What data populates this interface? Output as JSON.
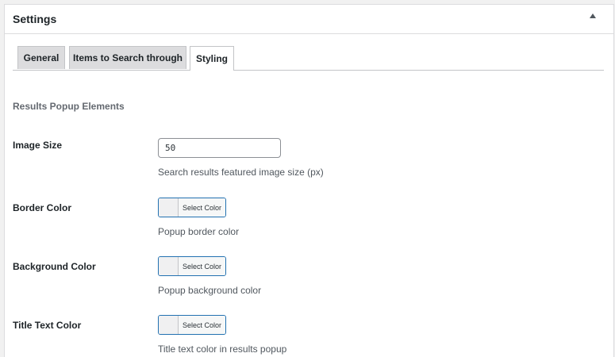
{
  "panel": {
    "title": "Settings",
    "toggle_icon": "triangle-up-icon"
  },
  "tabs": [
    {
      "label": "General",
      "active": false
    },
    {
      "label": "Items to Search through",
      "active": false
    },
    {
      "label": "Styling",
      "active": true
    }
  ],
  "section": {
    "title": "Results Popup Elements"
  },
  "fields": {
    "image_size": {
      "label": "Image Size",
      "value": "50",
      "description": "Search results featured image size (px)"
    },
    "border_color": {
      "label": "Border Color",
      "button_label": "Select Color",
      "description": "Popup border color"
    },
    "background_color": {
      "label": "Background Color",
      "button_label": "Select Color",
      "description": "Popup background color"
    },
    "title_text_color": {
      "label": "Title Text Color",
      "button_label": "Select Color",
      "description": "Title text color in results popup"
    }
  },
  "colors": {
    "accent": "#2271b1",
    "border": "#dcdcde",
    "tab_inactive": "#dcdcde"
  }
}
